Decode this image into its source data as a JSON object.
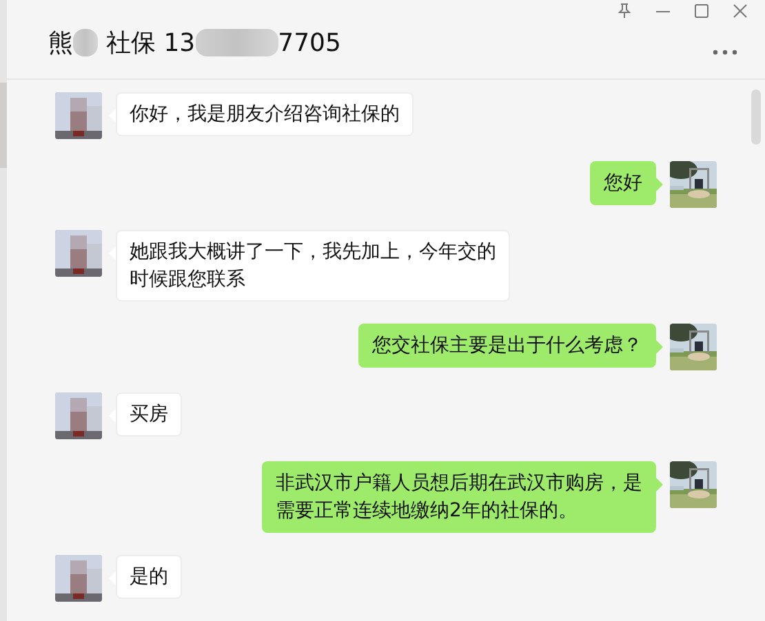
{
  "window": {
    "title_parts": [
      "熊",
      "社保 13",
      "7705"
    ]
  },
  "messages": [
    {
      "kind": "received",
      "text": "你好，我是朋友介绍咨询社保的"
    },
    {
      "kind": "sent",
      "text": "您好"
    },
    {
      "kind": "received",
      "text": "她跟我大概讲了一下，我先加上，今年交的时候跟您联系"
    },
    {
      "kind": "sent",
      "text": "您交社保主要是出于什么考虑？"
    },
    {
      "kind": "received",
      "text": "买房"
    },
    {
      "kind": "sent",
      "text": "非武汉市户籍人员想后期在武汉市购房，是需要正常连续地缴纳2年的社保的。"
    },
    {
      "kind": "received",
      "text": "是的"
    }
  ]
}
